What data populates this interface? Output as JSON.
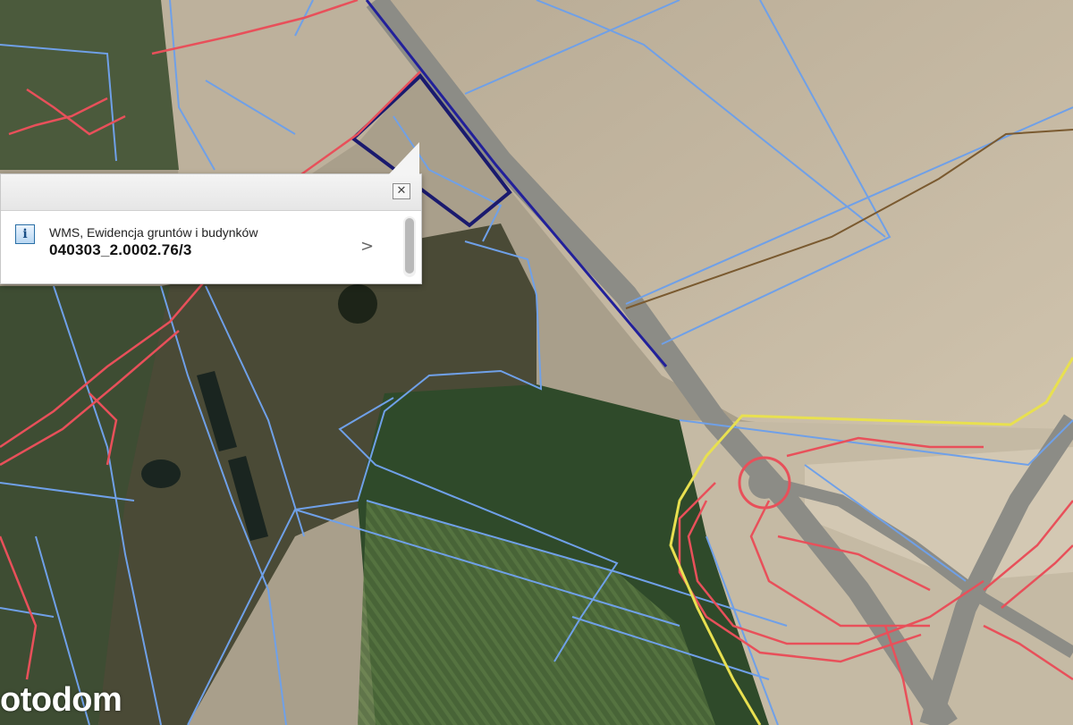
{
  "popup": {
    "close_icon": "close-icon",
    "info_icon": "i",
    "layer_name": "WMS, Ewidencja gruntów i budynków",
    "parcel_id": "040303_2.0002.76/3",
    "next_icon": ">"
  },
  "watermark": {
    "text": "otodom"
  },
  "colors": {
    "parcel_boundary": "#6fa0e8",
    "selected_parcel": "#1a1a6e",
    "road_lines": "#e8505a",
    "highlight_boundary": "#e8e050"
  }
}
